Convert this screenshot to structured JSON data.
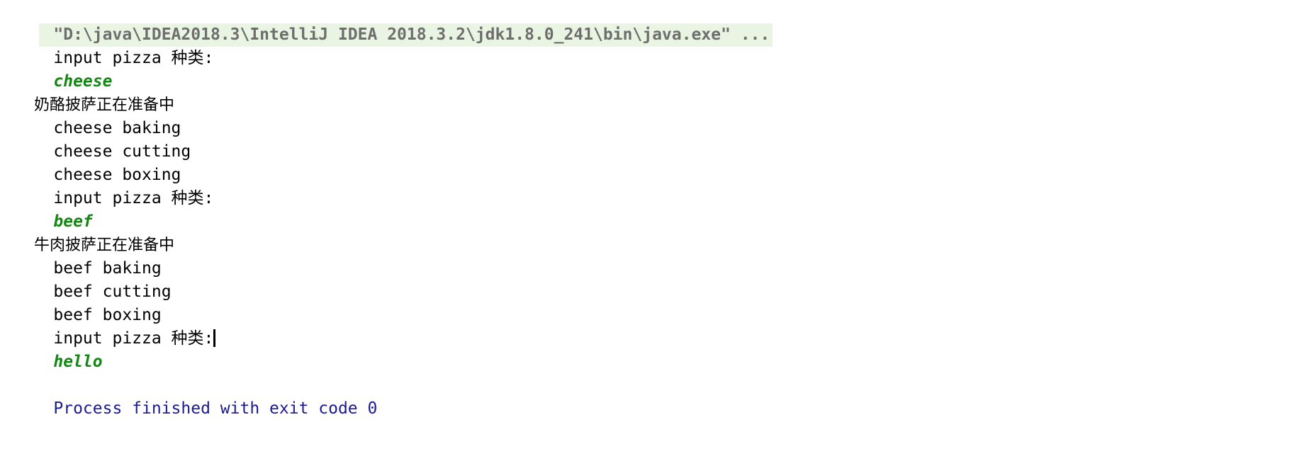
{
  "console": {
    "name": "intellij-run-console",
    "background_color": "#ffffff",
    "command_line": {
      "text": "\"D:\\java\\IDEA2018.3\\IntelliJ IDEA 2018.3.2\\jdk1.8.0_241\\bin\\java.exe\" ...",
      "text_color": "#6e6e6e",
      "highlight_color": "#e9f5e2"
    },
    "colors": {
      "stdout": "#000000",
      "stdin_echo": "#128712",
      "exit_message": "#1b1b8f",
      "caret": "#000000"
    },
    "lines": [
      {
        "text": "input pizza 种类:",
        "kind": "stdout"
      },
      {
        "text": "cheese",
        "kind": "stdin"
      },
      {
        "text": "奶酪披萨正在准备中",
        "kind": "stdout"
      },
      {
        "text": "cheese baking",
        "kind": "stdout"
      },
      {
        "text": "cheese cutting",
        "kind": "stdout"
      },
      {
        "text": "cheese boxing",
        "kind": "stdout"
      },
      {
        "text": "input pizza 种类:",
        "kind": "stdout"
      },
      {
        "text": "beef",
        "kind": "stdin"
      },
      {
        "text": "牛肉披萨正在准备中",
        "kind": "stdout"
      },
      {
        "text": "beef baking",
        "kind": "stdout"
      },
      {
        "text": "beef cutting",
        "kind": "stdout"
      },
      {
        "text": "beef boxing",
        "kind": "stdout"
      },
      {
        "text": "input pizza 种类:",
        "kind": "stdout",
        "caret": true
      },
      {
        "text": "hello",
        "kind": "stdin"
      },
      {
        "text": "",
        "kind": "blank"
      },
      {
        "text": "Process finished with exit code 0",
        "kind": "exit"
      }
    ],
    "line_texts": {
      "l01": "input pizza 种类:",
      "l02": "cheese",
      "l03": "奶酪披萨正在准备中",
      "l04": "cheese baking",
      "l05": "cheese cutting",
      "l06": "cheese boxing",
      "l07": "input pizza 种类:",
      "l08": "beef",
      "l09": "牛肉披萨正在准备中",
      "l10": "beef baking",
      "l11": "beef cutting",
      "l12": "beef boxing",
      "l13": "input pizza 种类:",
      "l14": "hello",
      "l16": "Process finished with exit code 0"
    }
  }
}
